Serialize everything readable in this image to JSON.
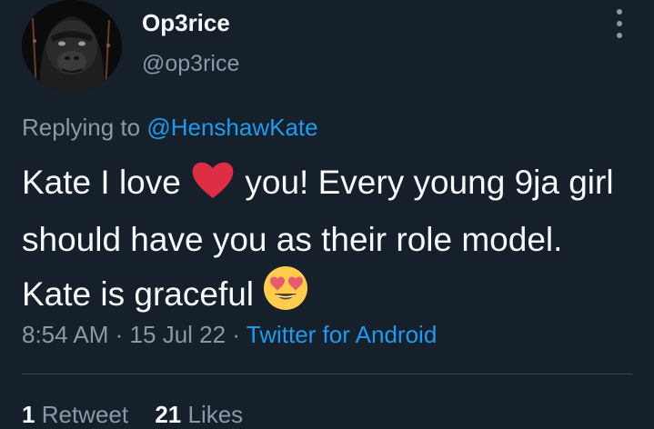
{
  "author": {
    "display_name": "Op3rice",
    "handle": "@op3rice",
    "avatar_icon": "gorilla-avatar"
  },
  "reply": {
    "prefix": "Replying to",
    "mention": "@HenshawKate"
  },
  "tweet": {
    "text_part1": "Kate I love",
    "text_part2": "you! Every young 9ja girl should have you as their role model. Kate is graceful",
    "emoji_heart": "red-heart-icon",
    "emoji_heart_eyes": "heart-eyes-icon"
  },
  "meta": {
    "time": "8:54 AM",
    "sep1": "·",
    "date": "15 Jul 22",
    "sep2": "·",
    "source": "Twitter for Android"
  },
  "stats": {
    "retweets_count": "1",
    "retweets_label": "Retweet",
    "likes_count": "21",
    "likes_label": "Likes"
  },
  "colors": {
    "background": "#15202b",
    "accent": "#1d9bf0",
    "secondary_text": "#8b98a5"
  }
}
